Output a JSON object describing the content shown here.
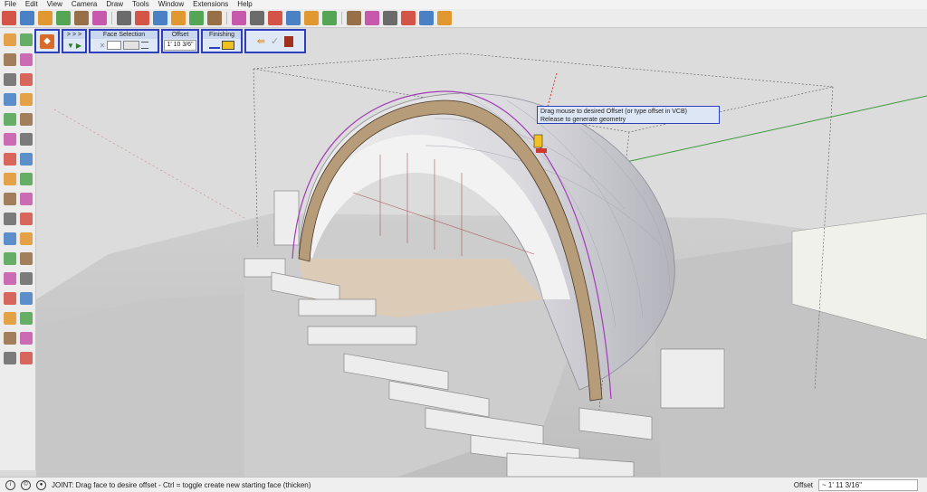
{
  "menu": [
    "File",
    "Edit",
    "View",
    "Camera",
    "Draw",
    "Tools",
    "Window",
    "Extensions",
    "Help"
  ],
  "toolbar": {
    "icons": [
      "select-icon",
      "eraser-icon",
      "line-icon",
      "arc-icon",
      "rectangle-icon",
      "pushpull-icon",
      "move-icon",
      "rotate-icon",
      "scale-icon",
      "offset-icon",
      "tape-icon",
      "text-icon",
      "paint-icon",
      "orbit-icon",
      "pan-icon",
      "zoom-icon",
      "zoom-extents-icon",
      "warehouse-icon",
      "extension-warehouse-icon",
      "layout-icon",
      "sandbox-icon",
      "style-icon",
      "section-icon",
      "component-icon"
    ]
  },
  "joint_toolbar": {
    "direction_label": "> > >",
    "face_selection_label": "Face Selection",
    "offset_label": "Offset",
    "offset_value": "1' 10 3/6\"",
    "finishing_label": "Finishing"
  },
  "tooltip": {
    "line1": "Drag mouse to desired Offset (or type offset in VCB)",
    "line2": "Release to generate geometry"
  },
  "status": {
    "text": "JOINT: Drag face to desire offset - Ctrl = toggle create new starting face (thicken)",
    "vcb_label": "Offset",
    "vcb_value": "~ 1' 11 3/16\""
  },
  "colors": {
    "accent": "#2d3fbd",
    "selection": "#a33bb8",
    "green_axis": "#3a9a3a",
    "red_axis": "#d03a2c"
  }
}
